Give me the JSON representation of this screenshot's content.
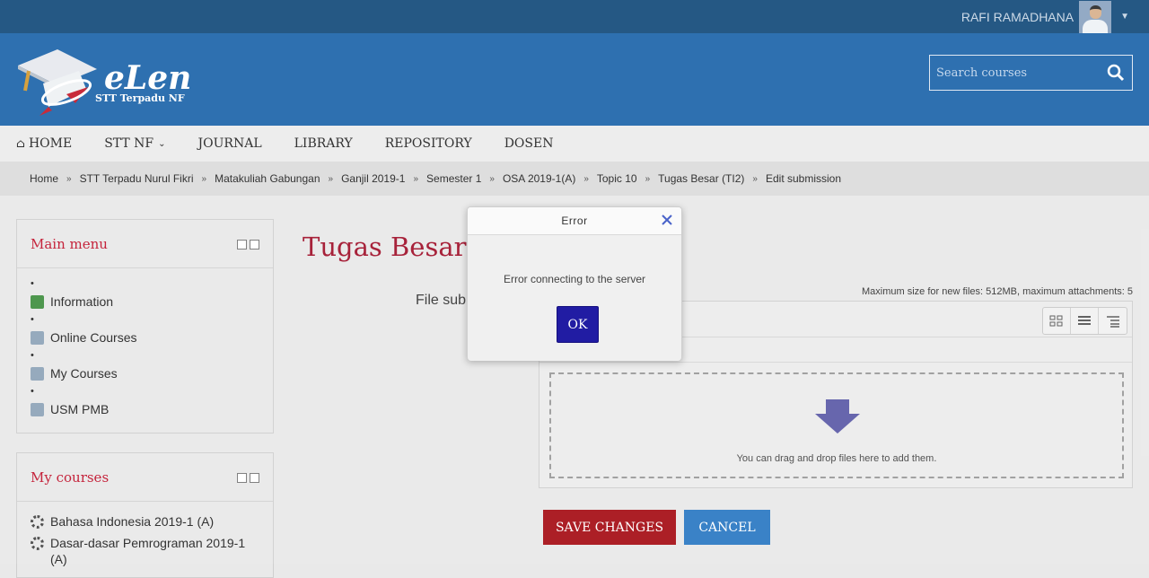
{
  "topbar": {
    "user_name": "RAFI RAMADHANA"
  },
  "header": {
    "logo_text": "eLen",
    "logo_sub": "STT Terpadu NF",
    "search_placeholder": "Search courses"
  },
  "nav": {
    "items": [
      "HOME",
      "STT NF",
      "JOURNAL",
      "LIBRARY",
      "REPOSITORY",
      "DOSEN"
    ]
  },
  "breadcrumb": [
    "Home",
    "STT Terpadu Nurul Fikri",
    "Matakuliah Gabungan",
    "Ganjil 2019-1",
    "Semester 1",
    "OSA 2019-1(A)",
    "Topic 10",
    "Tugas Besar (TI2)",
    "Edit submission"
  ],
  "main_menu": {
    "title": "Main menu",
    "items": [
      "Information",
      "Online Courses",
      "My Courses",
      "USM PMB"
    ]
  },
  "my_courses": {
    "title": "My courses",
    "items": [
      "Bahasa Indonesia 2019-1 (A)",
      "Dasar-dasar Pemrograman 2019-1 (A)"
    ]
  },
  "main": {
    "page_title": "Tugas Besar (T",
    "file_label": "File sub",
    "max_size": "Maximum size for new files: 512MB, maximum attachments: 5",
    "drop_text": "You can drag and drop files here to add them.",
    "save_label": "SAVE CHANGES",
    "cancel_label": "CANCEL"
  },
  "dialog": {
    "title": "Error",
    "message": "Error connecting to the server",
    "ok_label": "OK"
  },
  "colors": {
    "topbar": "#134a7a",
    "header": "#1d64aa",
    "accent_red": "#a50d14",
    "ok_button": "#211ca3"
  }
}
